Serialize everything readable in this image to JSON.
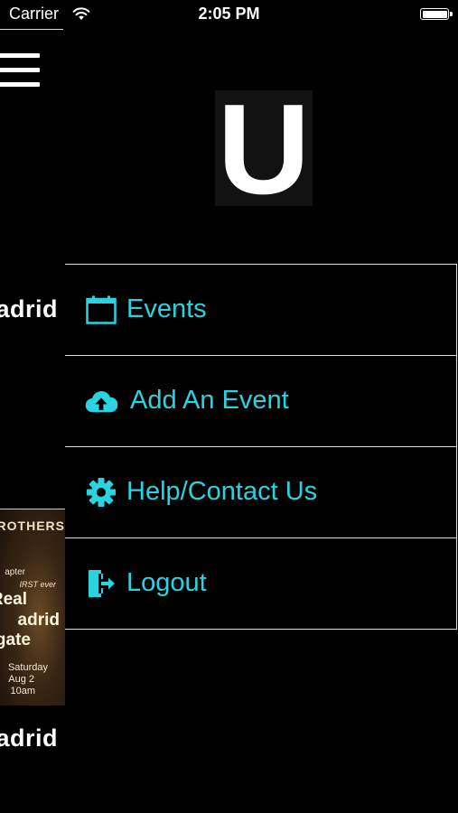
{
  "status_bar": {
    "carrier": "Carrier",
    "time": "2:05 PM",
    "battery_level": 1.0
  },
  "background_screen": {
    "titles": [
      "adrid",
      "adrid"
    ],
    "event_thumbnail": {
      "banner": "BROTHERS",
      "line1": "apter",
      "line2": "IRST ever",
      "big_line1": "Real",
      "big_line2": "adrid",
      "big_line3": "gate",
      "date_line1": "Saturday",
      "date_line2": "Aug 2",
      "date_line3": "10am"
    }
  },
  "menu": {
    "logo_letter": "U",
    "accent_color": "#29d3e0",
    "items": [
      {
        "label": "Events",
        "icon": "calendar-icon"
      },
      {
        "label": "Add An Event",
        "icon": "cloud-upload-icon"
      },
      {
        "label": "Help/Contact Us",
        "icon": "gear-icon"
      },
      {
        "label": "Logout",
        "icon": "logout-icon"
      }
    ]
  }
}
